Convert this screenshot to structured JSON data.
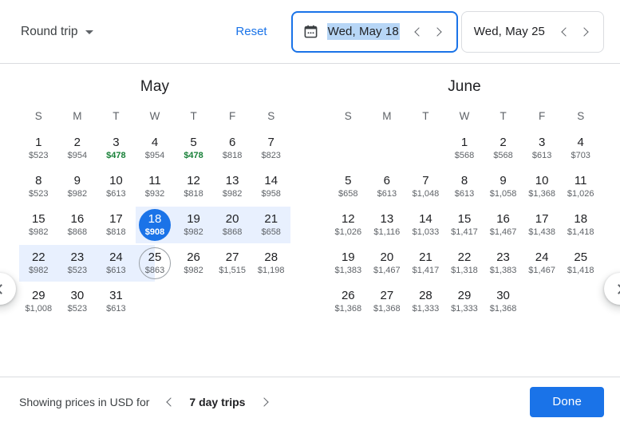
{
  "toolbar": {
    "trip_type": "Round trip",
    "trip_type_icon": "chevron-down-icon",
    "reset_label": "Reset",
    "departure": {
      "icon": "calendar-icon",
      "value": "Wed, May 18",
      "focused": true,
      "text_selected": true,
      "prev_icon": "chevron-left-icon",
      "next_icon": "chevron-right-icon"
    },
    "return": {
      "value": "Wed, May 25",
      "focused": false,
      "text_selected": false,
      "prev_icon": "chevron-left-icon",
      "next_icon": "chevron-right-icon"
    }
  },
  "nav": {
    "prev_icon": "chevron-left-icon",
    "next_icon": "chevron-right-icon"
  },
  "weekdays": [
    "S",
    "M",
    "T",
    "W",
    "T",
    "F",
    "S"
  ],
  "colors": {
    "accent": "#1a73e8",
    "range_band": "#e8f0fe",
    "cheap_price": "#188038",
    "text_selection": "#b7d6f6",
    "end_ring": "#9aa0a6"
  },
  "months": [
    {
      "name": "May",
      "weeks": [
        {
          "band": null,
          "days": [
            {
              "num": "1",
              "price": "$523",
              "cheap": false
            },
            {
              "num": "2",
              "price": "$954",
              "cheap": false
            },
            {
              "num": "3",
              "price": "$478",
              "cheap": true
            },
            {
              "num": "4",
              "price": "$954",
              "cheap": false
            },
            {
              "num": "5",
              "price": "$478",
              "cheap": true
            },
            {
              "num": "6",
              "price": "$818",
              "cheap": false
            },
            {
              "num": "7",
              "price": "$823",
              "cheap": false
            }
          ]
        },
        {
          "band": null,
          "days": [
            {
              "num": "8",
              "price": "$523",
              "cheap": false
            },
            {
              "num": "9",
              "price": "$982",
              "cheap": false
            },
            {
              "num": "10",
              "price": "$613",
              "cheap": false
            },
            {
              "num": "11",
              "price": "$932",
              "cheap": false
            },
            {
              "num": "12",
              "price": "$818",
              "cheap": false
            },
            {
              "num": "13",
              "price": "$982",
              "cheap": false
            },
            {
              "num": "14",
              "price": "$958",
              "cheap": false
            }
          ]
        },
        {
          "band": {
            "from_col": 3,
            "to_col": 7
          },
          "days": [
            {
              "num": "15",
              "price": "$982",
              "cheap": false
            },
            {
              "num": "16",
              "price": "$868",
              "cheap": false
            },
            {
              "num": "17",
              "price": "$818",
              "cheap": false
            },
            {
              "num": "18",
              "price": "$908",
              "cheap": false,
              "state": "start"
            },
            {
              "num": "19",
              "price": "$982",
              "cheap": false
            },
            {
              "num": "20",
              "price": "$868",
              "cheap": false
            },
            {
              "num": "21",
              "price": "$658",
              "cheap": false
            }
          ]
        },
        {
          "band": {
            "from_col": 0,
            "to_col": 3.5
          },
          "days": [
            {
              "num": "22",
              "price": "$982",
              "cheap": false
            },
            {
              "num": "23",
              "price": "$523",
              "cheap": false
            },
            {
              "num": "24",
              "price": "$613",
              "cheap": false
            },
            {
              "num": "25",
              "price": "$863",
              "cheap": false,
              "state": "end"
            },
            {
              "num": "26",
              "price": "$982",
              "cheap": false
            },
            {
              "num": "27",
              "price": "$1,515",
              "cheap": false
            },
            {
              "num": "28",
              "price": "$1,198",
              "cheap": false
            }
          ]
        },
        {
          "band": null,
          "days": [
            {
              "num": "29",
              "price": "$1,008",
              "cheap": false
            },
            {
              "num": "30",
              "price": "$523",
              "cheap": false
            },
            {
              "num": "31",
              "price": "$613",
              "cheap": false
            },
            null,
            null,
            null,
            null
          ]
        }
      ]
    },
    {
      "name": "June",
      "weeks": [
        {
          "band": null,
          "days": [
            null,
            null,
            null,
            {
              "num": "1",
              "price": "$568",
              "cheap": false
            },
            {
              "num": "2",
              "price": "$568",
              "cheap": false
            },
            {
              "num": "3",
              "price": "$613",
              "cheap": false
            },
            {
              "num": "4",
              "price": "$703",
              "cheap": false
            }
          ]
        },
        {
          "band": null,
          "days": [
            {
              "num": "5",
              "price": "$658",
              "cheap": false
            },
            {
              "num": "6",
              "price": "$613",
              "cheap": false
            },
            {
              "num": "7",
              "price": "$1,048",
              "cheap": false
            },
            {
              "num": "8",
              "price": "$613",
              "cheap": false
            },
            {
              "num": "9",
              "price": "$1,058",
              "cheap": false
            },
            {
              "num": "10",
              "price": "$1,368",
              "cheap": false
            },
            {
              "num": "11",
              "price": "$1,026",
              "cheap": false
            }
          ]
        },
        {
          "band": null,
          "days": [
            {
              "num": "12",
              "price": "$1,026",
              "cheap": false
            },
            {
              "num": "13",
              "price": "$1,116",
              "cheap": false
            },
            {
              "num": "14",
              "price": "$1,033",
              "cheap": false
            },
            {
              "num": "15",
              "price": "$1,417",
              "cheap": false
            },
            {
              "num": "16",
              "price": "$1,467",
              "cheap": false
            },
            {
              "num": "17",
              "price": "$1,438",
              "cheap": false
            },
            {
              "num": "18",
              "price": "$1,418",
              "cheap": false
            }
          ]
        },
        {
          "band": null,
          "days": [
            {
              "num": "19",
              "price": "$1,383",
              "cheap": false
            },
            {
              "num": "20",
              "price": "$1,467",
              "cheap": false
            },
            {
              "num": "21",
              "price": "$1,417",
              "cheap": false
            },
            {
              "num": "22",
              "price": "$1,318",
              "cheap": false
            },
            {
              "num": "23",
              "price": "$1,383",
              "cheap": false
            },
            {
              "num": "24",
              "price": "$1,467",
              "cheap": false
            },
            {
              "num": "25",
              "price": "$1,418",
              "cheap": false
            }
          ]
        },
        {
          "band": null,
          "days": [
            {
              "num": "26",
              "price": "$1,368",
              "cheap": false
            },
            {
              "num": "27",
              "price": "$1,368",
              "cheap": false
            },
            {
              "num": "28",
              "price": "$1,333",
              "cheap": false
            },
            {
              "num": "29",
              "price": "$1,333",
              "cheap": false
            },
            {
              "num": "30",
              "price": "$1,368",
              "cheap": false
            },
            null,
            null
          ]
        }
      ]
    }
  ],
  "footer": {
    "note_label": "Showing prices in USD for",
    "prev_icon": "chevron-left-icon",
    "trip_length": "7 day trips",
    "next_icon": "chevron-right-icon",
    "done_label": "Done"
  }
}
